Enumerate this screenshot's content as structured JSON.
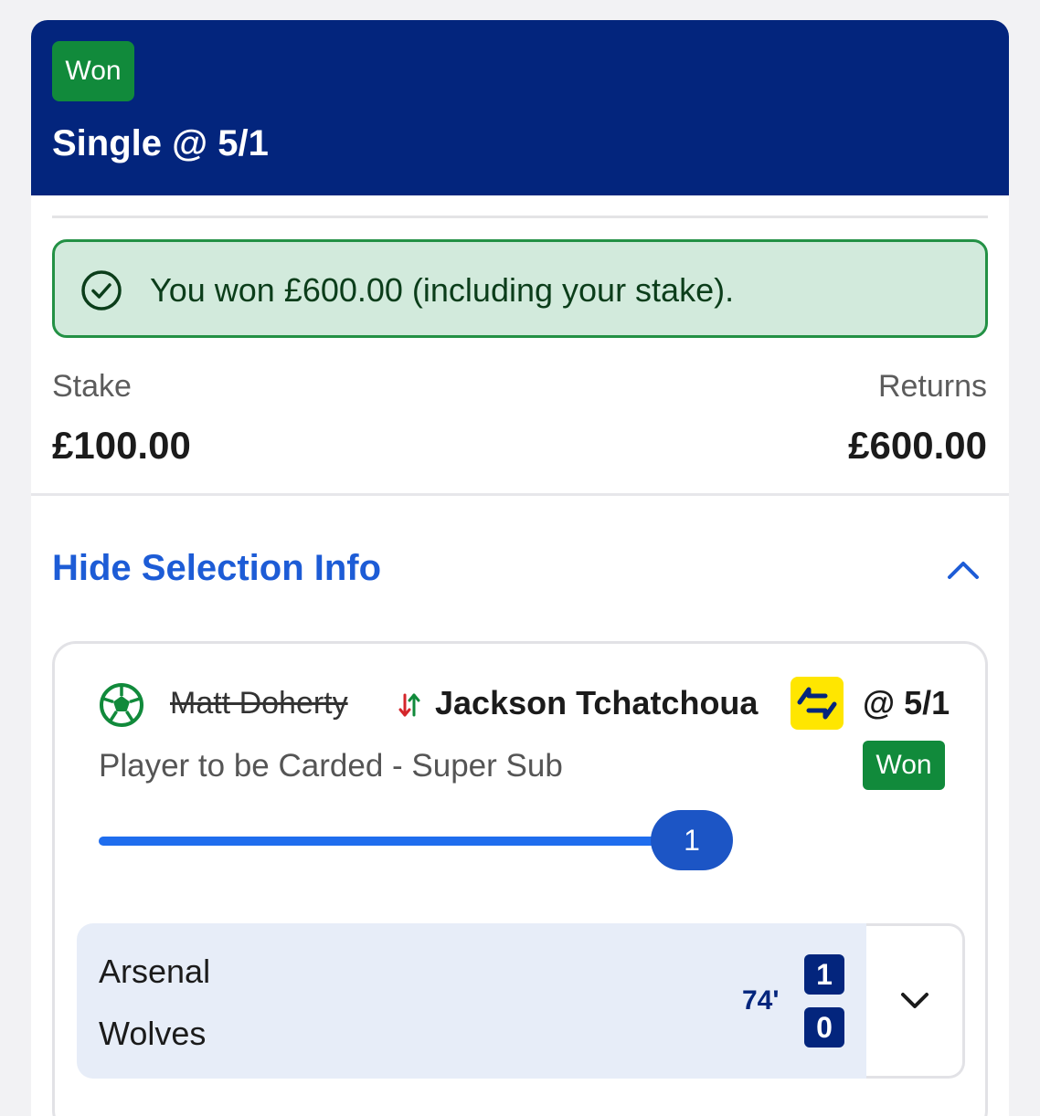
{
  "header": {
    "status": "Won",
    "title": "Single @ 5/1"
  },
  "banner": {
    "message": "You won £600.00 (including your stake)."
  },
  "summary": {
    "stake_label": "Stake",
    "stake_value": "£100.00",
    "returns_label": "Returns",
    "returns_value": "£600.00"
  },
  "selection_toggle": {
    "label": "Hide Selection Info"
  },
  "selection": {
    "sport_icon": "football-icon",
    "original_player": "Matt Doherty",
    "substitute_player": "Jackson Tchatchoua",
    "super_sub_icon": "super-sub-swap-icon",
    "odds": "@ 5/1",
    "market": "Player to be Carded - Super Sub",
    "status": "Won",
    "progress_label": "1",
    "progress_fraction": 1.0
  },
  "match": {
    "home_team": "Arsenal",
    "away_team": "Wolves",
    "time": "74'",
    "home_score": "1",
    "away_score": "0"
  },
  "colors": {
    "header_bg": "#03257d",
    "won_green": "#118a3b",
    "banner_bg": "#d2eadc",
    "link_blue": "#1d5cd6",
    "progress_blue": "#1f6dee",
    "super_sub_yellow": "#ffe600"
  }
}
